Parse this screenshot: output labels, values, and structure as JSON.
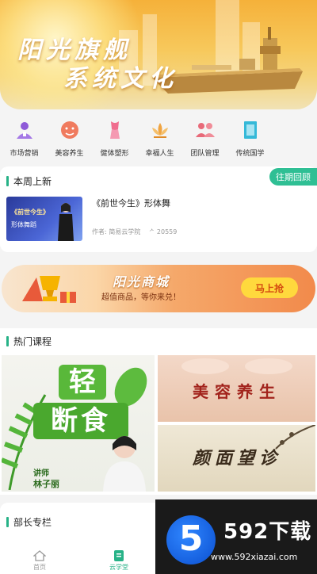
{
  "banner": {
    "line1": "阳光旗舰",
    "line2": "系统文化"
  },
  "categories": [
    {
      "label": "市场营销",
      "icon": "person-badge-icon",
      "color": "#8e5ad8"
    },
    {
      "label": "美容养生",
      "icon": "face-icon",
      "color": "#f07b5f"
    },
    {
      "label": "健体塑形",
      "icon": "body-shape-icon",
      "color": "#f06d8e"
    },
    {
      "label": "幸福人生",
      "icon": "lotus-icon",
      "color": "#f0a441"
    },
    {
      "label": "团队管理",
      "icon": "team-icon",
      "color": "#e86a79"
    },
    {
      "label": "传统国学",
      "icon": "book-icon",
      "color": "#35b9d8"
    }
  ],
  "new_this_week": {
    "title": "本周上新",
    "history_button": "往期回顾",
    "course": {
      "thumb_line1": "《前世今生》",
      "thumb_line2": "形体舞蹈",
      "title": "《前世今生》形体舞",
      "author": "作者: 简易云学院",
      "views": "20559"
    }
  },
  "mall": {
    "title": "阳光商城",
    "subtitle": "超值商品，等你来兑！",
    "button": "马上抢"
  },
  "hot_courses": {
    "title": "热门课程",
    "tiles": [
      {
        "line1": "轻",
        "line2": "断食",
        "teacher": "讲师",
        "name": "林子丽"
      },
      {
        "text": "美容养生"
      },
      {
        "text": "颜面望诊"
      }
    ]
  },
  "minister": {
    "title": "部长专栏"
  },
  "tabbar": [
    {
      "label": "首页",
      "icon": "home-icon",
      "active": false
    },
    {
      "label": "云学堂",
      "icon": "book-tab-icon",
      "active": true
    }
  ],
  "watermark": {
    "logo": "5",
    "brand": "592下载",
    "url": "www.592xiazai.com"
  },
  "colors": {
    "accent": "#27b287",
    "mall_button": "#ffd93d"
  }
}
